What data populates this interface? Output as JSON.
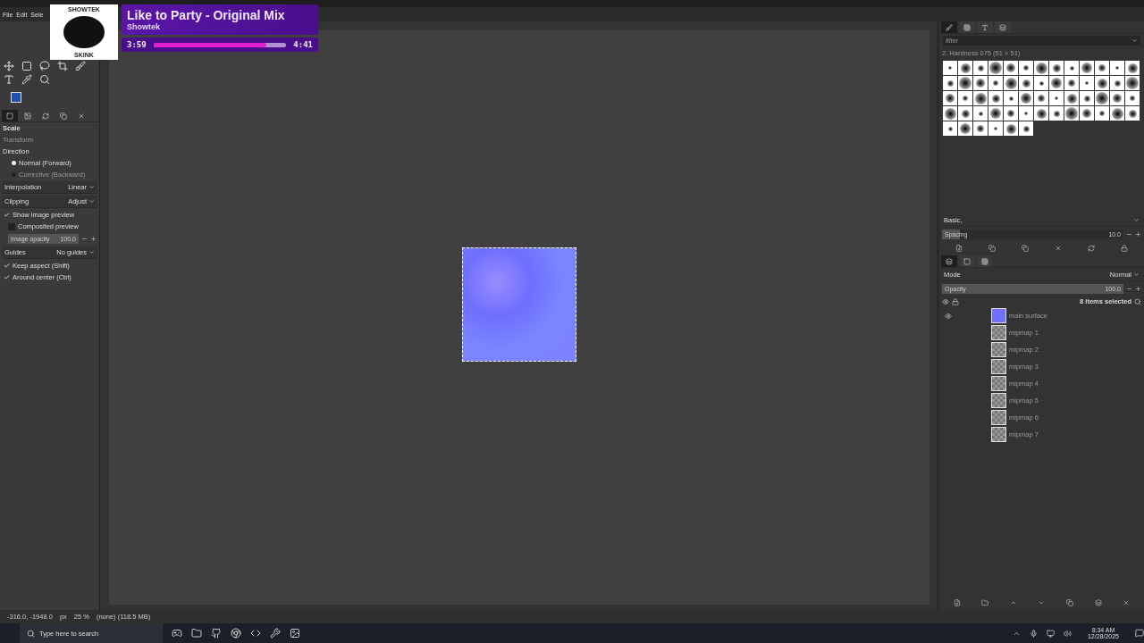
{
  "menu": [
    {
      "label": "File"
    },
    {
      "label": "Edit"
    },
    {
      "label": "Sele"
    }
  ],
  "now_playing": {
    "cover_title": "SHOWTEK",
    "cover_label": "SKINK",
    "title": "Like to Party - Original Mix",
    "artist": "Showtek",
    "elapsed": "3:59",
    "total": "4:41",
    "level": 0.85
  },
  "tool_options": {
    "tabs": [
      {
        "selected": true
      },
      {
        "selected": false
      },
      {
        "selected": false
      },
      {
        "selected": false
      },
      {
        "selected": false
      }
    ],
    "title": "Scale",
    "transform_label": "Transform",
    "direction_label": "Direction",
    "directions": [
      {
        "label": "Normal (Forward)",
        "selected": true
      },
      {
        "label": "Corrective (Backward)",
        "selected": false
      }
    ],
    "interpolation": {
      "label": "Interpolation",
      "value": "Linear"
    },
    "clipping": {
      "label": "Clipping",
      "value": "Adjust"
    },
    "preview_checks": [
      {
        "label": "Show image preview",
        "checked": true
      },
      {
        "label": "Composited preview",
        "checked": false
      }
    ],
    "image_opacity": {
      "label": "Image opacity",
      "value": "100.0",
      "level": 1
    },
    "guides": {
      "label": "Guides",
      "value": "No guides"
    },
    "checks": [
      {
        "label": "Keep aspect (Shift)",
        "checked": true
      },
      {
        "label": "Around center (Ctrl)",
        "checked": true
      }
    ]
  },
  "brushes": {
    "tabs": [
      {
        "selected": true
      },
      {
        "selected": false
      },
      {
        "selected": false
      },
      {
        "selected": false
      }
    ],
    "placeholder": "filter",
    "current": "2. Hardness 075 (51 × 51)",
    "preset": "Basic,",
    "spacing": {
      "label": "Spacing",
      "value": "10.0",
      "level": 0.1
    }
  },
  "layers": {
    "tabs": [
      {
        "selected": true
      },
      {
        "selected": false
      },
      {
        "selected": false
      }
    ],
    "mode_label": "Mode",
    "mode": "Normal",
    "opacity": {
      "label": "Opacity",
      "value": "100.0",
      "level": 1
    },
    "selection": "8 items selected",
    "items": [
      {
        "name": "main surface",
        "visible": true
      },
      {
        "name": "mipmap 1",
        "visible": false
      },
      {
        "name": "mipmap 2",
        "visible": false
      },
      {
        "name": "mipmap 3",
        "visible": false
      },
      {
        "name": "mipmap 4",
        "visible": false
      },
      {
        "name": "mipmap 5",
        "visible": false
      },
      {
        "name": "mipmap 6",
        "visible": false
      },
      {
        "name": "mipmap 7",
        "visible": false
      }
    ]
  },
  "status_bar": {
    "coords": "-316.0, -1948.0",
    "unit": "px",
    "zoom": "25 %",
    "info": "(none) (118.5 MB)"
  },
  "taskbar": {
    "search_placeholder": "Type here to search",
    "time": "8:34 AM",
    "date": "12/28/2025"
  }
}
